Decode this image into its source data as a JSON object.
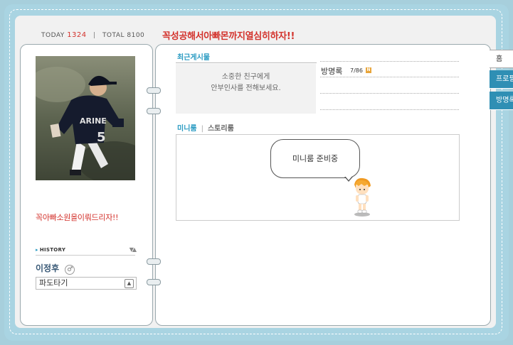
{
  "header": {
    "today_label": "TODAY",
    "today_count": "1324",
    "total_label": "TOTAL",
    "total_count": "8100",
    "title": "꼭성공해서아빠몬까지열심히하자!!"
  },
  "profile": {
    "quote": "꼭아빠소원을이뤄드리자!!",
    "history_label": "HISTORY",
    "name": "이정후",
    "gender_symbol": "♂",
    "wave_select_value": "파도타기"
  },
  "recent_posts": {
    "title": "최근게시물",
    "message_line1": "소중한 친구에게",
    "message_line2": "안부인사를 전해보세요."
  },
  "guestbook": {
    "label": "방명록",
    "count": "7/86",
    "new_badge": "N"
  },
  "room_tabs": {
    "miniroom": "미니룸",
    "storyroom": "스토리룸"
  },
  "miniroom": {
    "bubble_text": "미니룸 준비중"
  },
  "side_nav": [
    {
      "label": "홈"
    },
    {
      "label": "프로필"
    },
    {
      "label": "방명록"
    }
  ],
  "colors": {
    "accent_blue": "#2a9bc2",
    "title_red": "#d3322c",
    "frame_blue": "#a9d4e2",
    "side_tab_blue": "#2f8fb4"
  }
}
